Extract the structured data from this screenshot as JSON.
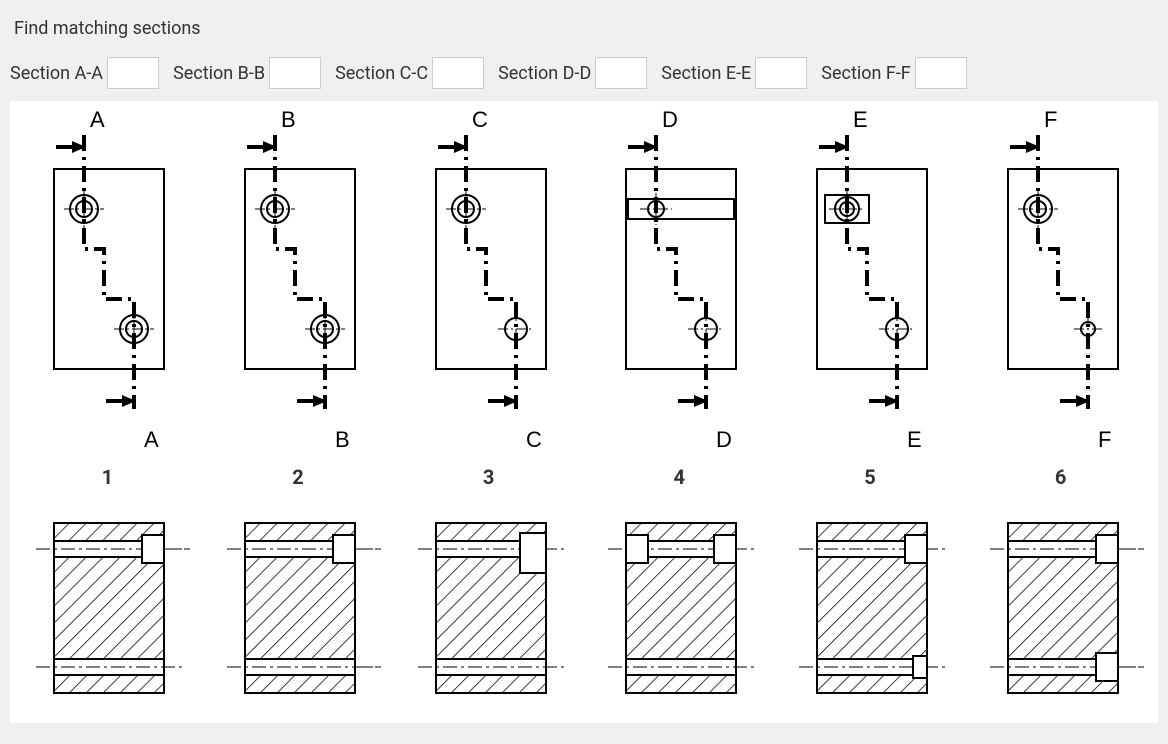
{
  "question": "Find matching sections",
  "inputs": [
    {
      "label": "Section A-A",
      "value": ""
    },
    {
      "label": "Section B-B",
      "value": ""
    },
    {
      "label": "Section C-C",
      "value": ""
    },
    {
      "label": "Section D-D",
      "value": ""
    },
    {
      "label": "Section E-E",
      "value": ""
    },
    {
      "label": "Section F-F",
      "value": ""
    }
  ],
  "plans": [
    {
      "letter": "A",
      "top_feature": "double_circle",
      "bottom_feature": "double_circle"
    },
    {
      "letter": "B",
      "top_feature": "double_circle",
      "bottom_feature": "double_circle"
    },
    {
      "letter": "C",
      "top_feature": "double_circle",
      "bottom_feature": "single_circle"
    },
    {
      "letter": "D",
      "top_feature": "slot_circle",
      "bottom_feature": "single_circle"
    },
    {
      "letter": "E",
      "top_feature": "box_circle",
      "bottom_feature": "single_circle"
    },
    {
      "letter": "F",
      "top_feature": "double_circle",
      "bottom_feature": "tiny_circle"
    }
  ],
  "sections": [
    {
      "number": "1",
      "top_break": "right_notch",
      "bottom_break": "none",
      "right_dash": "top"
    },
    {
      "number": "2",
      "top_break": "right_notch",
      "bottom_break": "none",
      "right_dash": "both"
    },
    {
      "number": "3",
      "top_break": "right_inset",
      "bottom_break": "none",
      "right_dash": "none"
    },
    {
      "number": "4",
      "top_break": "both_notch",
      "bottom_break": "none",
      "right_dash": "none"
    },
    {
      "number": "5",
      "top_break": "right_notch",
      "bottom_break": "right_tiny",
      "right_dash": "none"
    },
    {
      "number": "6",
      "top_break": "right_notch",
      "bottom_break": "right_notch",
      "right_dash": "both"
    }
  ]
}
